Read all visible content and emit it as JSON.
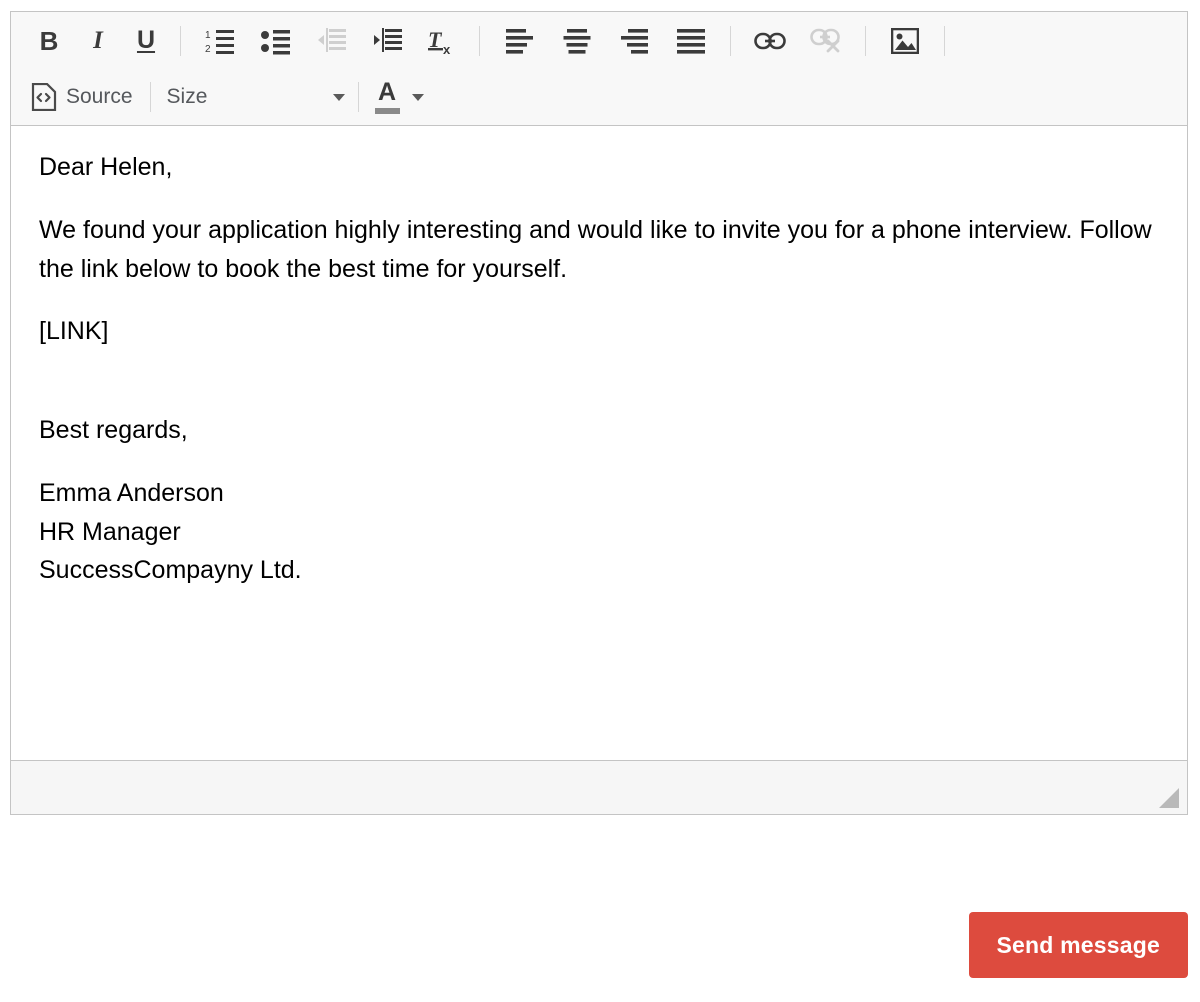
{
  "editor": {
    "toolbar": {
      "row1": [
        {
          "name": "bold-button",
          "icon": "bold-icon",
          "label": "B",
          "title": "Bold",
          "disabled": false
        },
        {
          "name": "italic-button",
          "icon": "italic-icon",
          "label": "I",
          "title": "Italic",
          "disabled": false
        },
        {
          "name": "underline-button",
          "icon": "underline-icon",
          "label": "U",
          "title": "Underline",
          "disabled": false
        },
        {
          "name": "numbered-list-button",
          "icon": "numbered-list-icon",
          "label": "",
          "title": "Insert/Remove Numbered List",
          "disabled": false
        },
        {
          "name": "bulleted-list-button",
          "icon": "bulleted-list-icon",
          "label": "",
          "title": "Insert/Remove Bulleted List",
          "disabled": false
        },
        {
          "name": "decrease-indent-button",
          "icon": "decrease-indent-icon",
          "label": "",
          "title": "Decrease Indent",
          "disabled": true
        },
        {
          "name": "increase-indent-button",
          "icon": "increase-indent-icon",
          "label": "",
          "title": "Increase Indent",
          "disabled": false
        },
        {
          "name": "remove-format-button",
          "icon": "remove-format-icon",
          "label": "",
          "title": "Remove Format",
          "disabled": false
        },
        {
          "name": "align-left-button",
          "icon": "align-left-icon",
          "label": "",
          "title": "Align Left",
          "disabled": false
        },
        {
          "name": "align-center-button",
          "icon": "align-center-icon",
          "label": "",
          "title": "Center",
          "disabled": false
        },
        {
          "name": "align-right-button",
          "icon": "align-right-icon",
          "label": "",
          "title": "Align Right",
          "disabled": false
        },
        {
          "name": "justify-button",
          "icon": "justify-icon",
          "label": "",
          "title": "Justify",
          "disabled": false
        },
        {
          "name": "link-button",
          "icon": "link-icon",
          "label": "",
          "title": "Link",
          "disabled": false
        },
        {
          "name": "unlink-button",
          "icon": "unlink-icon",
          "label": "",
          "title": "Unlink",
          "disabled": true
        },
        {
          "name": "image-button",
          "icon": "image-icon",
          "label": "",
          "title": "Image",
          "disabled": false
        }
      ],
      "source_label": "Source",
      "size_label": "Size",
      "size_options": [
        "Size"
      ],
      "text_color_letter": "A"
    },
    "content": {
      "greeting": "Dear Helen,",
      "paragraph": "We found your application highly interesting and would like to invite you for a phone interview. Follow the link below to book the best time for yourself.",
      "link_placeholder": "[LINK]",
      "closing": "Best regards,",
      "signature_name": "Emma Anderson",
      "signature_title": "HR Manager",
      "signature_company": "SuccessCompayny Ltd."
    },
    "footer": {
      "status_text": "",
      "resize_handle": "resize-grip"
    }
  },
  "actions": {
    "send_label": "Send message"
  },
  "colors": {
    "accent": "#dd4b3e",
    "toolbar_bg": "#f8f8f8",
    "footer_bg": "#f6f6f6",
    "border": "#c4c4c4",
    "icon": "#3b3b3b",
    "icon_disabled": "#cfcfcf",
    "text": "#000000"
  }
}
